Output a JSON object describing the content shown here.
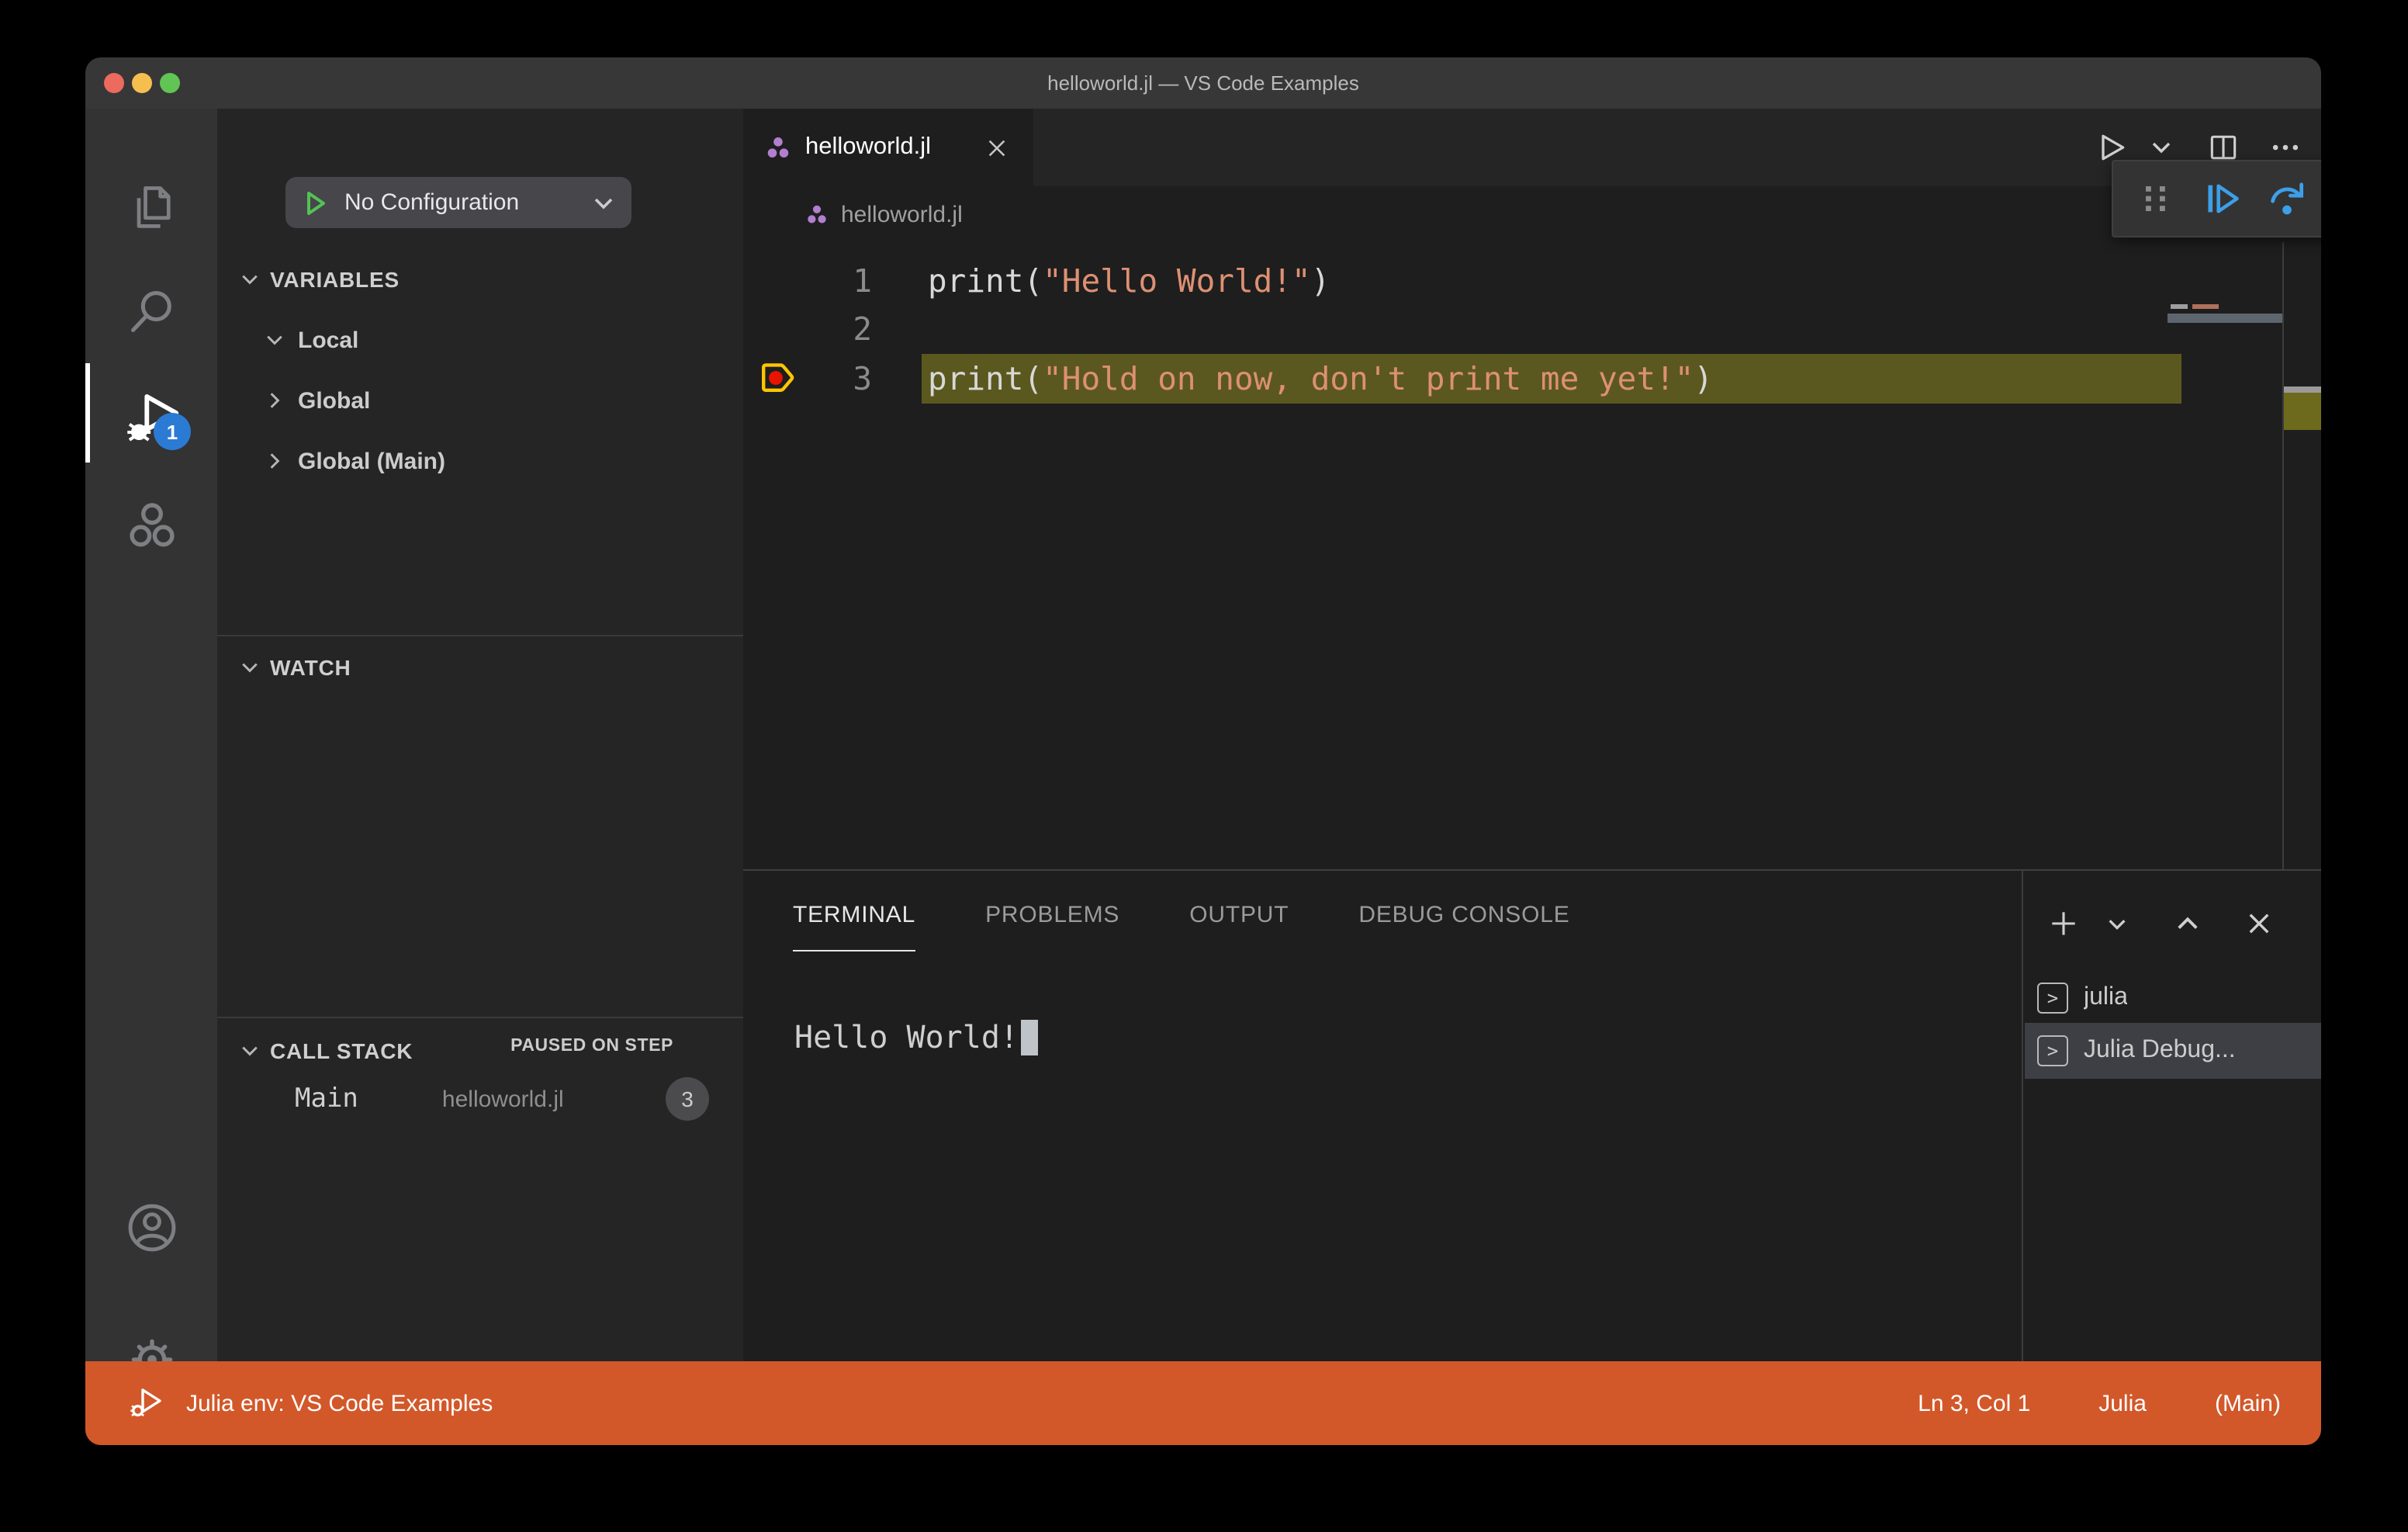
{
  "window": {
    "title": "helloworld.jl — VS Code Examples"
  },
  "activity_bar": {
    "debug_badge": "1"
  },
  "sidebar": {
    "config_button": {
      "label": "No Configuration"
    },
    "variables": {
      "title": "VARIABLES",
      "items": [
        {
          "label": "Local"
        },
        {
          "label": "Global"
        },
        {
          "label": "Global (Main)"
        }
      ]
    },
    "watch": {
      "title": "WATCH"
    },
    "call_stack": {
      "title": "CALL STACK",
      "status": "PAUSED ON STEP",
      "frame": {
        "name": "Main",
        "file": "helloworld.jl",
        "line": "3"
      }
    }
  },
  "editor": {
    "tab": {
      "label": "helloworld.jl"
    },
    "breadcrumb": "helloworld.jl",
    "lines": [
      {
        "num": "1",
        "fn": "print",
        "open": "(",
        "str": "\"Hello World!\"",
        "close": ")"
      },
      {
        "num": "2",
        "fn": "",
        "open": "",
        "str": "",
        "close": ""
      },
      {
        "num": "3",
        "fn": "print",
        "open": "(",
        "str": "\"Hold on now, don't print me yet!\"",
        "close": ")"
      }
    ]
  },
  "panel": {
    "tabs": {
      "terminal": "TERMINAL",
      "problems": "PROBLEMS",
      "output": "OUTPUT",
      "debug_console": "DEBUG CONSOLE"
    },
    "active_tab": "TERMINAL",
    "terminal_output": "Hello World!",
    "terminals": [
      {
        "label": "julia"
      },
      {
        "label": "Julia Debug..."
      }
    ]
  },
  "status_bar": {
    "env": "Julia env: VS Code Examples",
    "cursor": "Ln 3, Col 1",
    "language": "Julia",
    "repl": "(Main)"
  },
  "colors": {
    "status_bar": "#d2582a",
    "activity_badge": "#2b7bd4",
    "string_token": "#dd9073",
    "line_highlight": "#5b581f",
    "breakpoint_ring": "#ffc502",
    "breakpoint_dot": "#e81400",
    "debug_blue": "#3d9fe8",
    "debug_green": "#71c171",
    "debug_stop_red": "#f2826e",
    "julia_purple": "#b27fd0",
    "traffic_close": "#ec6a5e",
    "traffic_minimize": "#f5bf4f",
    "traffic_zoom": "#61c455"
  },
  "icons": {
    "explorer-icon": "overlapping-pages",
    "search-icon": "magnifier",
    "run-debug-icon": "play-with-bug",
    "julia-icon": "three-circles",
    "account-icon": "person-circle",
    "settings-gear-icon": "gear",
    "continue-icon": "bar-play",
    "step-over-icon": "arc-over-dot",
    "step-into-icon": "arrow-down-dot",
    "step-out-icon": "arrow-up-dot",
    "restart-icon": "circular-arrow",
    "stop-icon": "square-outline",
    "run-icon": "play-outline",
    "split-editor-icon": "split-rect",
    "more-icon": "ellipsis",
    "new-terminal-icon": "plus",
    "terminal-item-icon": "boxed-chevron"
  }
}
